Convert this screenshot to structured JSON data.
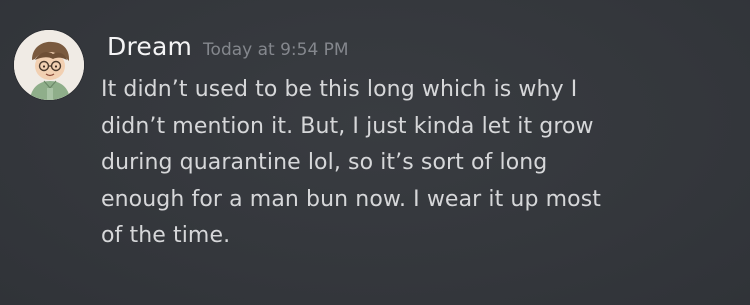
{
  "message": {
    "author": "Dream",
    "timestamp": "Today at 9:54 PM",
    "avatar_icon": "cartoon-character-avatar-icon",
    "avatar_label": "Dream",
    "lines": [
      "It didn’t used to be this long which is why I",
      "didn’t mention it. But, I just kinda let it grow",
      "during quarantine lol, so it’s sort of long",
      "enough for a man bun now. I wear it up most",
      "of the time."
    ]
  },
  "colors": {
    "background": "#35383d",
    "username": "#f4f4f5",
    "timestamp": "#84878d",
    "message_text": "#d6d7d9"
  }
}
